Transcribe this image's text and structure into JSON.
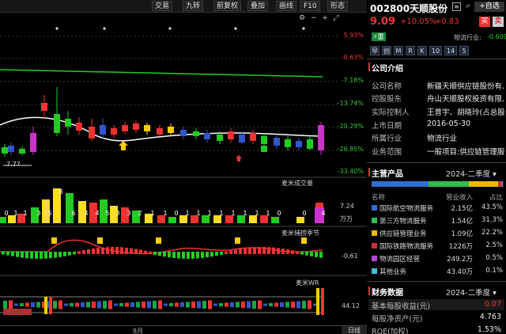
{
  "toolbar": {
    "buttons": [
      "交易",
      "九转",
      "前复权",
      "叠加",
      "画线",
      "F10",
      "形态"
    ]
  },
  "main_chart": {
    "pct_labels": [
      "5.93%",
      "-0.63%",
      "-7.18%",
      "-13.74%",
      "-20.29%",
      "-26.85%",
      "-33.40%"
    ],
    "low_label": "7.77",
    "line_color": "#22cc22"
  },
  "volume_panel": {
    "title": "麦米成交量",
    "value": "7.24",
    "unit": "万万",
    "counts": [
      "0",
      "1",
      "1",
      "3",
      "5",
      "8",
      "6",
      "4",
      "4",
      "5",
      "3",
      "3",
      "2",
      "1",
      "1",
      "0",
      "1",
      "1",
      "1",
      "1",
      "1",
      "1",
      "1",
      "1",
      "0",
      "0",
      "4"
    ]
  },
  "season_panel": {
    "title": "麦米捕捞季节",
    "value": "-0.61"
  },
  "wr_panel": {
    "title": "麦米WR",
    "value": "44.12"
  },
  "bottom": {
    "month": "8月",
    "period": "日线"
  },
  "quote": {
    "code_name": "002800天顺股份",
    "price": "9.09",
    "change_pct": "+10.05%",
    "change": "+0.83",
    "buy": "买",
    "sell": "卖",
    "add_watch": "+自选",
    "tag": "雷",
    "industry_label": "物流行业:",
    "industry_change": "-0.609"
  },
  "period_buttons": [
    "早",
    "创",
    "M",
    "R",
    "K",
    "10",
    "14",
    "5"
  ],
  "company": {
    "title": "公司介绍",
    "rows": [
      {
        "k": "公司名称",
        "v": "新疆天顺供应链股份有..."
      },
      {
        "k": "控股股东",
        "v": "舟山天顺股权投资有限..."
      },
      {
        "k": "实际控制人",
        "v": "王普宇、胡晓玲(占总股..."
      },
      {
        "k": "上市日期",
        "v": "2016-05-30"
      },
      {
        "k": "所属行业",
        "v": "物流行业"
      },
      {
        "k": "业务范围",
        "v": "一般项目:供应链管理服..."
      }
    ]
  },
  "products": {
    "title": "主营产品",
    "period": "2024-二季度",
    "headers": [
      "名称",
      "营业收入",
      "占比"
    ],
    "rows": [
      {
        "name": "国际航空物流服务",
        "revenue": "2.15亿",
        "share": "43.5%",
        "color": "#2f6fd6"
      },
      {
        "name": "第三方物流服务",
        "revenue": "1.54亿",
        "share": "31.3%",
        "color": "#2fbf4f"
      },
      {
        "name": "供应链管理业务",
        "revenue": "1.09亿",
        "share": "22.2%",
        "color": "#f0b800"
      },
      {
        "name": "国际铁路物流服务",
        "revenue": "1226万",
        "share": "2.5%",
        "color": "#d03030"
      },
      {
        "name": "物流园区经营",
        "revenue": "249.2万",
        "share": "0.5%",
        "color": "#b04ad0"
      },
      {
        "name": "其他业务",
        "revenue": "43.40万",
        "share": "0.1%",
        "color": "#3fc0e0"
      }
    ],
    "bar_shares": [
      43.5,
      31.3,
      22.2,
      2.5,
      0.5,
      0.1
    ]
  },
  "finance": {
    "title": "财务数据",
    "period": "2024-二季度",
    "rows": [
      {
        "k": "基本每股收益(元)",
        "v": "0.07",
        "color": "#e33"
      },
      {
        "k": "每股净资产(元)",
        "v": "4.763",
        "color": "#eee"
      },
      {
        "k": "ROE(加权)",
        "v": "1.53%",
        "color": "#eee"
      }
    ]
  },
  "chart_data": {
    "type": "candlestick",
    "colors": {
      "up": "#e33",
      "down": "#2c2",
      "flat": "#fff"
    }
  }
}
